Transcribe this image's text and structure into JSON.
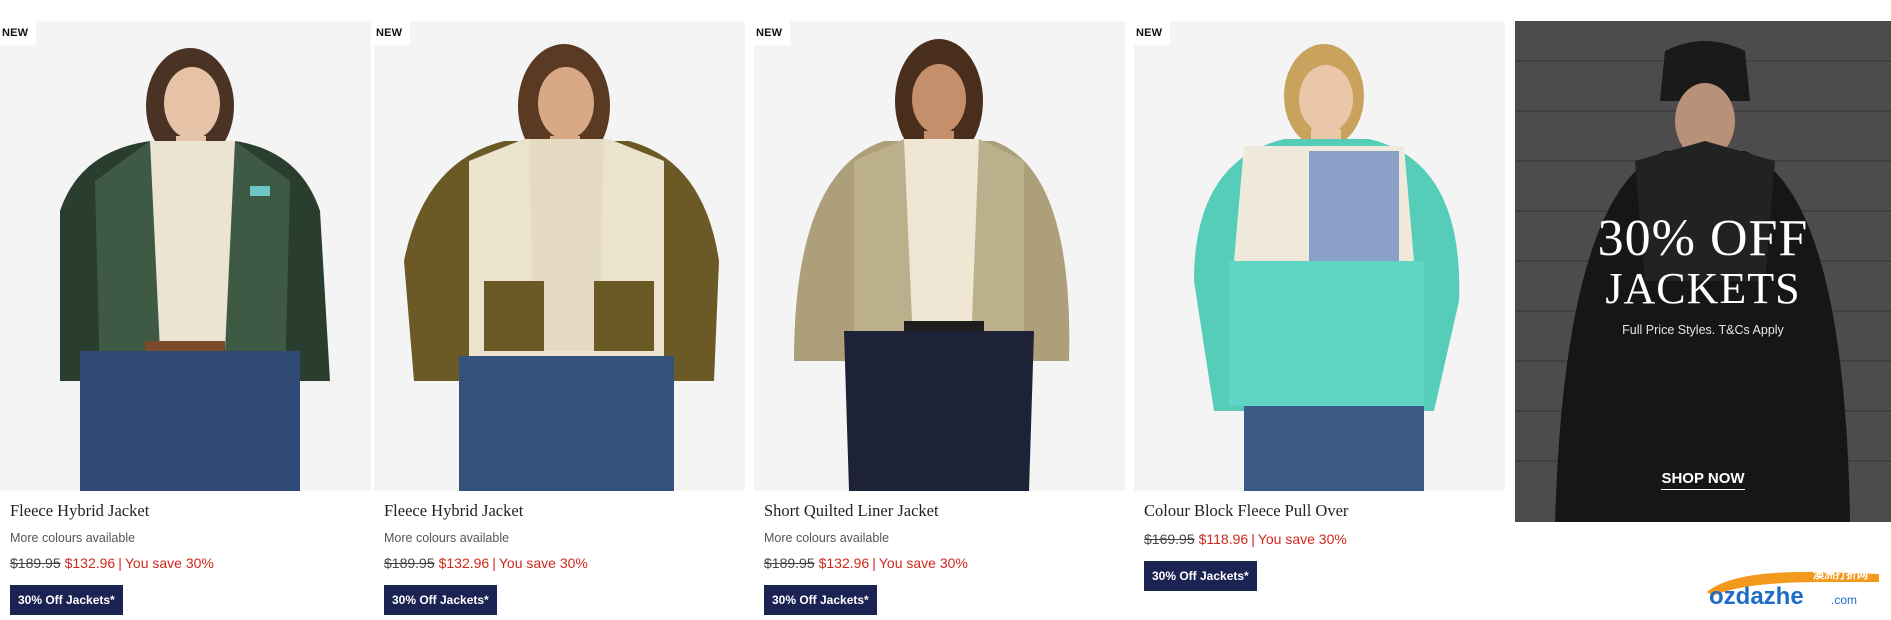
{
  "products": [
    {
      "badge": "NEW",
      "title": "Fleece Hybrid Jacket",
      "more": "More colours available",
      "was": "$189.95",
      "now": "$132.96",
      "sep": "|",
      "save": "You save 30%",
      "promo": "30% Off Jackets*",
      "colors": {
        "main": "#3e5a44",
        "sleeve": "#2a3e30",
        "top": "#ece4d2",
        "jeans": "#2f4a76"
      }
    },
    {
      "badge": "NEW",
      "title": "Fleece Hybrid Jacket",
      "more": "More colours available",
      "was": "$189.95",
      "now": "$132.96",
      "sep": "|",
      "save": "You save 30%",
      "promo": "30% Off Jackets*",
      "colors": {
        "main": "#ece3cf",
        "sleeve": "#6b5a26",
        "top": "#e5dbc3",
        "jeans": "#35527e"
      }
    },
    {
      "badge": "NEW",
      "title": "Short Quilted Liner Jacket",
      "more": "More colours available",
      "was": "$189.95",
      "now": "$132.96",
      "sep": "|",
      "save": "You save 30%",
      "promo": "30% Off Jackets*",
      "colors": {
        "main": "#bcb08c",
        "sleeve": "#ad9f79",
        "top": "#efe6d3",
        "jeans": "#1d2236"
      }
    },
    {
      "badge": "NEW",
      "title": "Colour Block Fleece Pull Over",
      "more": "",
      "was": "$169.95",
      "now": "$118.96",
      "sep": "|",
      "save": "You save 30%",
      "promo": "30% Off Jackets*",
      "colors": {
        "main": "#5fd6c4",
        "sleeve": "#55cdb9",
        "top": "#efe9dc",
        "jeans": "#3c5a86"
      }
    }
  ],
  "promo_panel": {
    "headline_line1": "30% OFF",
    "headline_line2": "JACKETS",
    "terms": "Full Price Styles. T&Cs Apply",
    "cta": "SHOP NOW"
  },
  "watermark": {
    "brand": "ozdazhe",
    "tld": ".com",
    "tag": "澳洲打折网"
  },
  "theme": {
    "sale_red": "#d0281c",
    "promo_navy": "#1b2352",
    "image_bg": "#f4f4f4"
  }
}
